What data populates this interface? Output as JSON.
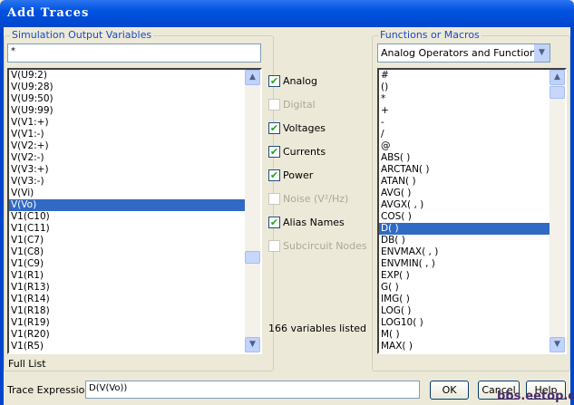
{
  "title": "Add Traces",
  "left": {
    "group_label": "Simulation Output Variables",
    "filter_value": "*",
    "variables": [
      "V(U9:2)",
      "V(U9:28)",
      "V(U9:50)",
      "V(U9:99)",
      "V(V1:+)",
      "V(V1:-)",
      "V(V2:+)",
      "V(V2:-)",
      "V(V3:+)",
      "V(V3:-)",
      "V(Vi)",
      "V(Vo)",
      "V1(C10)",
      "V1(C11)",
      "V1(C7)",
      "V1(C8)",
      "V1(C9)",
      "V1(R1)",
      "V1(R13)",
      "V1(R14)",
      "V1(R18)",
      "V1(R19)",
      "V1(R20)",
      "V1(R5)"
    ],
    "selected_index": 11,
    "footer": "Full List"
  },
  "filters": [
    {
      "label": "Analog",
      "checked": true,
      "enabled": true
    },
    {
      "label": "Digital",
      "checked": false,
      "enabled": false
    },
    {
      "label": "Voltages",
      "checked": true,
      "enabled": true
    },
    {
      "label": "Currents",
      "checked": true,
      "enabled": true
    },
    {
      "label": "Power",
      "checked": true,
      "enabled": true
    },
    {
      "label": "Noise (V²/Hz)",
      "checked": false,
      "enabled": false
    },
    {
      "label": "Alias Names",
      "checked": true,
      "enabled": true
    },
    {
      "label": "Subcircuit Nodes",
      "checked": false,
      "enabled": false
    }
  ],
  "count_text": "166 variables listed",
  "right": {
    "group_label": "Functions or Macros",
    "dropdown_value": "Analog Operators and Functions",
    "functions": [
      "#",
      "()",
      "*",
      "+",
      "-",
      "/",
      "@",
      "ABS( )",
      "ARCTAN( )",
      "ATAN( )",
      "AVG( )",
      "AVGX( , )",
      "COS( )",
      "D( )",
      "DB( )",
      "ENVMAX( , )",
      "ENVMIN( , )",
      "EXP( )",
      "G( )",
      "IMG( )",
      "LOG( )",
      "LOG10( )",
      "M( )",
      "MAX( )"
    ],
    "selected_index": 13
  },
  "bottom": {
    "trace_label": "Trace Expression:",
    "trace_value": "D(V(Vo))",
    "ok": "OK",
    "cancel": "Cancel",
    "help": "Help"
  },
  "watermark": "bbs.eetop.cn"
}
